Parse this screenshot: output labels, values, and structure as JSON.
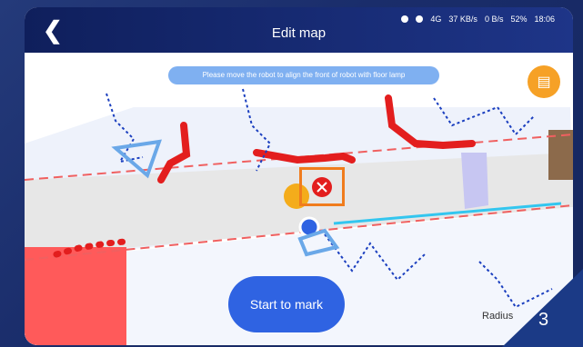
{
  "header": {
    "title": "Edit map",
    "back_icon": "chevron-left-icon"
  },
  "status_bar": {
    "signal_text": "4G",
    "speed_text": "37 KB/s",
    "wifi_speed": "0 B/s",
    "battery": "52%",
    "time": "18:06"
  },
  "hint": {
    "text": "Please move the robot to align the front of robot with floor lamp"
  },
  "buttons": {
    "start_label": "Start to mark"
  },
  "legend": {
    "radius_label": "Radius"
  },
  "slide_number": "3",
  "icons": {
    "book": "book-icon",
    "close": "close-icon",
    "robot": "robot-marker-icon"
  },
  "colors": {
    "accent": "#2f63e2",
    "obstacle": "#e31e1e",
    "hint_bg": "#7fb0f1",
    "orange": "#f6a126",
    "highlight": "#f07c1d"
  }
}
